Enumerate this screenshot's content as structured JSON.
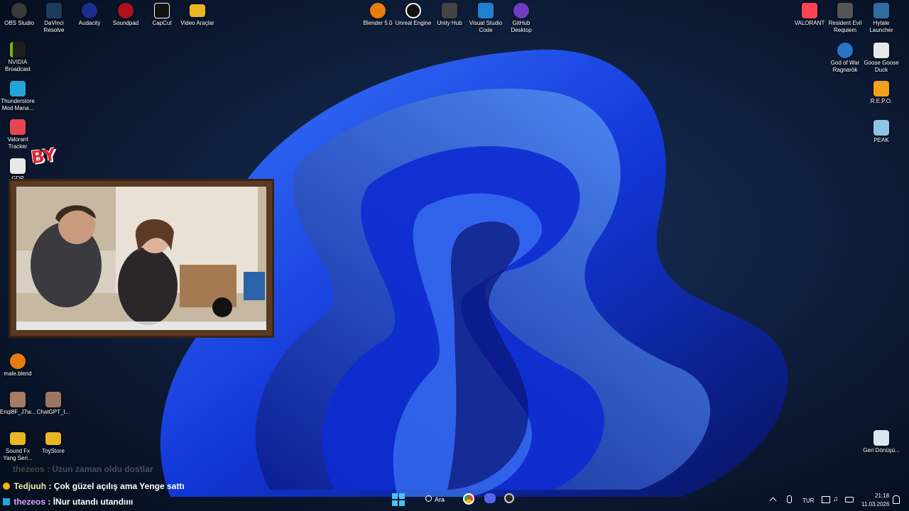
{
  "desktop_icons_top_left": [
    {
      "label": "OBS Studio",
      "icon": "obs-icon",
      "color": "#3a3a3a"
    },
    {
      "label": "DaVinci Resolve",
      "icon": "davinci-icon",
      "color": "#1d3b5c"
    },
    {
      "label": "Audacity",
      "icon": "audacity-icon",
      "color": "#1b2d8f"
    },
    {
      "label": "Soundpad",
      "icon": "soundpad-icon",
      "color": "#b0121a"
    },
    {
      "label": "CapCut",
      "icon": "capcut-icon",
      "color": "#111111"
    },
    {
      "label": "Video Araçlar",
      "icon": "folder-icon",
      "color": "#e8b723"
    }
  ],
  "desktop_icons_top_center": [
    {
      "label": "Blender 5.0",
      "icon": "blender-icon",
      "color": "#e87d0d"
    },
    {
      "label": "Unreal Engine",
      "icon": "unreal-icon",
      "color": "#111111"
    },
    {
      "label": "Unity Hub",
      "icon": "unity-icon",
      "color": "#444444"
    },
    {
      "label": "Visual Studio Code",
      "icon": "vscode-icon",
      "color": "#1f7fd3"
    },
    {
      "label": "GitHub Desktop",
      "icon": "github-desktop-icon",
      "color": "#6f3bc4"
    }
  ],
  "desktop_icons_top_right": [
    {
      "label": "VALORANT",
      "icon": "valorant-icon",
      "color": "#fa4454"
    },
    {
      "label": "Resident Evil Requiem",
      "icon": "resident-evil-icon",
      "color": "#555555"
    },
    {
      "label": "Hytale Launcher",
      "icon": "hytale-icon",
      "color": "#2f6d9e"
    }
  ],
  "desktop_icons_right_col": [
    {
      "label": "God of War Ragnarök",
      "icon": "god-of-war-icon",
      "color": "#2a74c9"
    },
    {
      "label": "Goose Goose Duck",
      "icon": "goose-icon",
      "color": "#e7e7e7"
    },
    {
      "label": "R.E.P.O.",
      "icon": "repo-icon",
      "color": "#f2a11d"
    },
    {
      "label": "PEAK",
      "icon": "peak-icon",
      "color": "#8fc4e8"
    },
    {
      "label": "Geri Dönüşü...",
      "icon": "recycle-bin-icon",
      "color": "#d8e6ef"
    }
  ],
  "desktop_icons_left_col": [
    {
      "label": "NVIDIA Broadcast",
      "icon": "nvidia-icon",
      "color": "#1e1e1e"
    },
    {
      "label": "Thunderstore Mod Mana...",
      "icon": "thunderstore-icon",
      "color": "#23a5d8"
    },
    {
      "label": "Valorant Tracker",
      "icon": "tracker-icon",
      "color": "#e84554"
    },
    {
      "label": "GDP",
      "icon": "gdp-icon",
      "color": "#e8e8e8"
    }
  ],
  "desktop_icons_left_lower": [
    {
      "label": "male.blend",
      "icon": "blend-file-icon",
      "color": "#e87d0d"
    },
    {
      "label": "Enql8F_J7w...",
      "icon": "image-file-icon",
      "color": "#a57b63"
    },
    {
      "label": "ChatGPT_I...",
      "icon": "image-file-icon",
      "color": "#9d7660"
    },
    {
      "label": "Sound Fx Yang Seri...",
      "icon": "folder-icon",
      "color": "#e8b723"
    },
    {
      "label": "ToyStore",
      "icon": "folder-icon",
      "color": "#e8b723"
    }
  ],
  "overlay_logo": "BY",
  "chat": {
    "messages": [
      {
        "user": "thezeos",
        "text": "Uzun zaman oldu dostlar",
        "faded": true
      },
      {
        "user": "Tedjuuh",
        "text": "Çok güzel açılış ama Yenge sattı",
        "faded": false
      },
      {
        "user": "thezeos",
        "text": "İNur utandı utandıııı",
        "faded": false
      }
    ]
  },
  "taskbar": {
    "search_label": "Ara",
    "language": "TUR",
    "time": "21:18",
    "date": "11.03.2026"
  },
  "colors": {
    "wallpaper_dark": "#08152b",
    "bloom_blue": "#1f4bff",
    "chat_user": "#f4e9a6"
  }
}
